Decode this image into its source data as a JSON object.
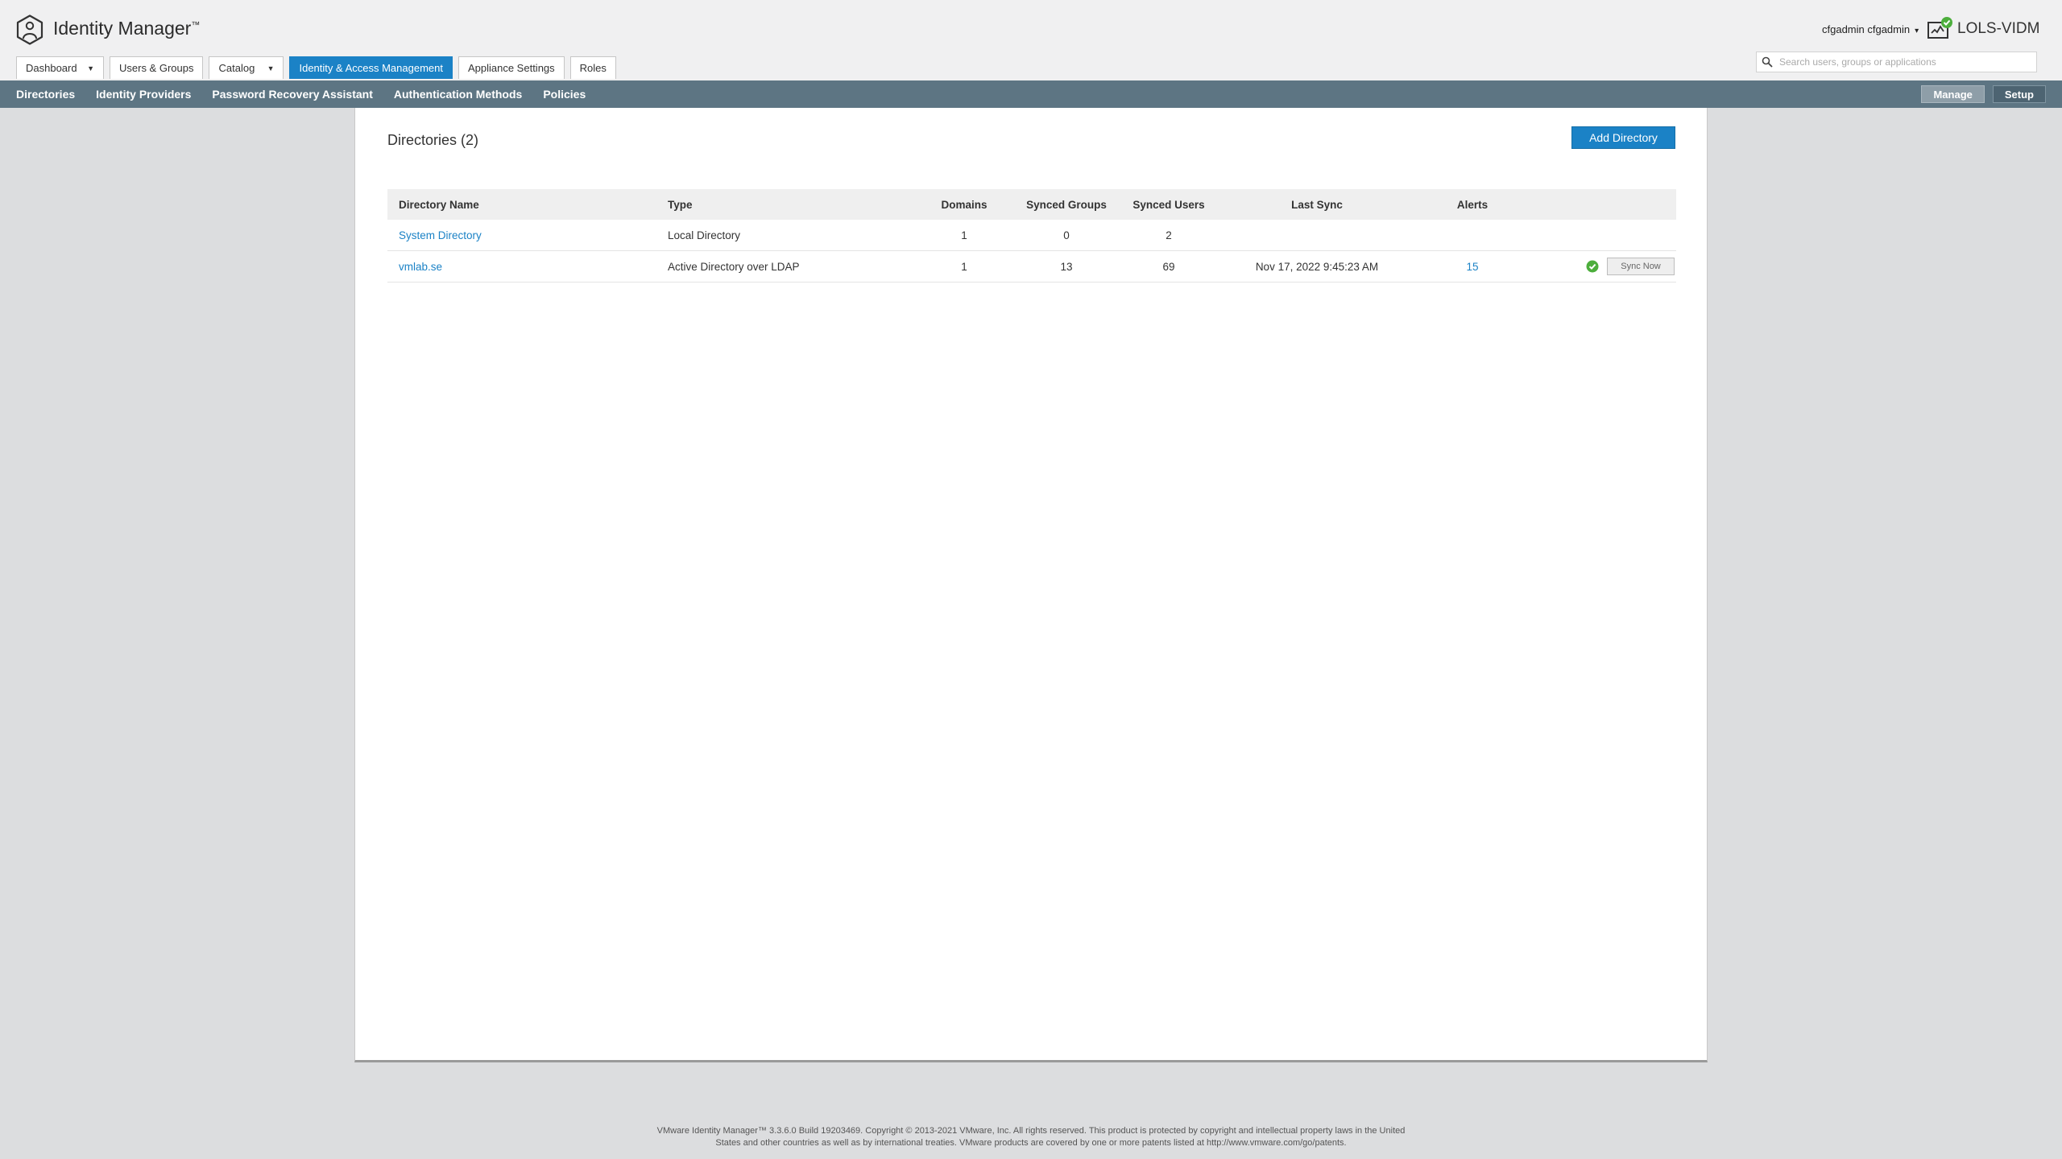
{
  "header": {
    "app_title": "Identity Manager",
    "app_title_tm": "™",
    "user_name": "cfgadmin cfgadmin",
    "user_caret": "▾",
    "tenant_name": "LOLS-VIDM",
    "search_placeholder": "Search users, groups or applications"
  },
  "main_tabs": [
    {
      "label": "Dashboard",
      "dropdown": true
    },
    {
      "label": "Users & Groups",
      "dropdown": false
    },
    {
      "label": "Catalog",
      "dropdown": true
    },
    {
      "label": "Identity & Access Management",
      "dropdown": false,
      "active": true
    },
    {
      "label": "Appliance Settings",
      "dropdown": false
    },
    {
      "label": "Roles",
      "dropdown": false
    }
  ],
  "subnav": {
    "items": [
      "Directories",
      "Identity Providers",
      "Password Recovery Assistant",
      "Authentication Methods",
      "Policies"
    ],
    "manage_label": "Manage",
    "setup_label": "Setup"
  },
  "panel": {
    "title": "Directories (2)",
    "add_button": "Add Directory"
  },
  "table": {
    "headers": {
      "name": "Directory Name",
      "type": "Type",
      "domains": "Domains",
      "synced_groups": "Synced Groups",
      "synced_users": "Synced Users",
      "last_sync": "Last Sync",
      "alerts": "Alerts"
    },
    "rows": [
      {
        "name": "System Directory",
        "type": "Local Directory",
        "domains": "1",
        "synced_groups": "0",
        "synced_users": "2",
        "last_sync": "",
        "alerts": "",
        "sync_button": ""
      },
      {
        "name": "vmlab.se",
        "type": "Active Directory over LDAP",
        "domains": "1",
        "synced_groups": "13",
        "synced_users": "69",
        "last_sync": "Nov 17, 2022 9:45:23 AM",
        "alerts": "15",
        "sync_button": "Sync Now"
      }
    ]
  },
  "footer": {
    "line1": "VMware Identity Manager™ 3.3.6.0 Build 19203469. Copyright © 2013-2021 VMware, Inc. All rights reserved. This product is protected by copyright and intellectual property laws in the United",
    "line2": "States and other countries as well as by international treaties. VMware products are covered by one or more patents listed at http://www.vmware.com/go/patents."
  },
  "colors": {
    "accent": "#1b82c6",
    "subnav_bg": "#5d7583",
    "status_ok": "#4cae3c"
  },
  "icons": [
    "identity-manager-logo-icon",
    "tenant-status-icon",
    "search-icon",
    "sync-ok-icon",
    "dropdown-caret-icon"
  ]
}
